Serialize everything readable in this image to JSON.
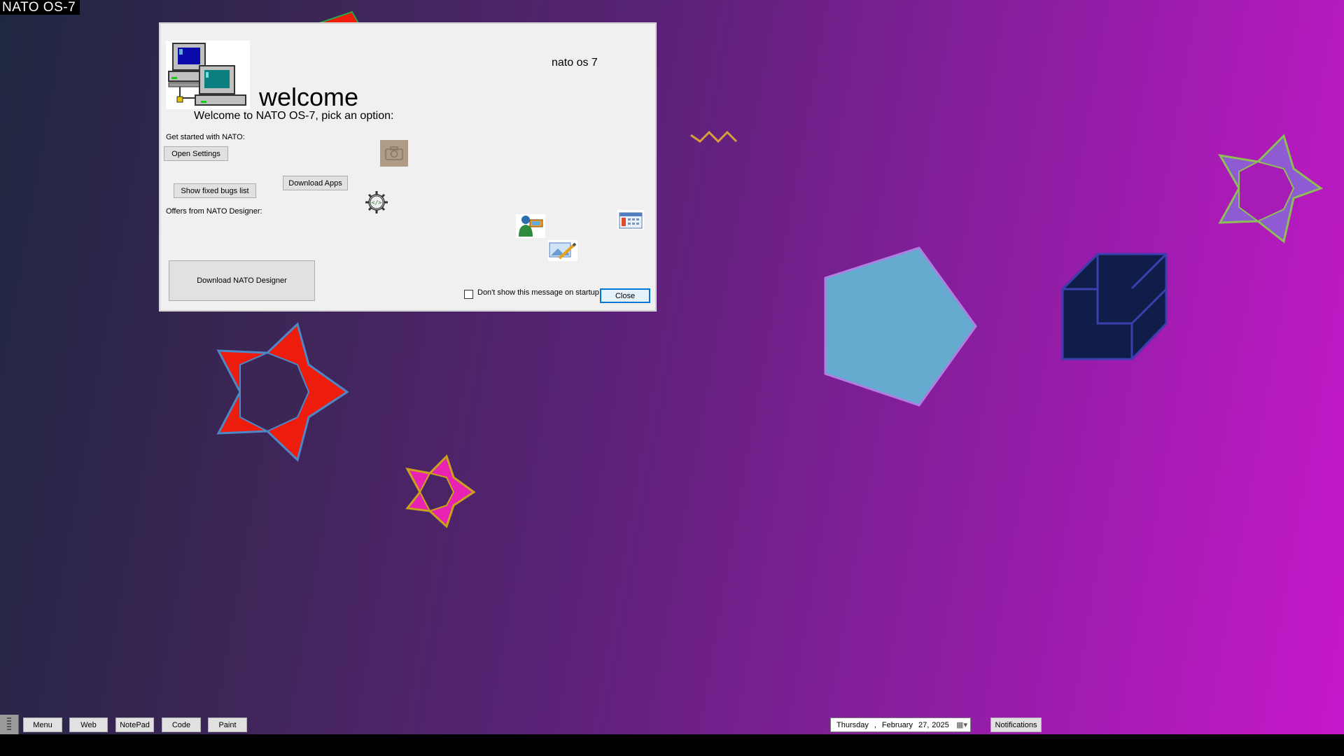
{
  "os_title": "NATO OS-7",
  "welcome_window": {
    "brand": "nato os 7",
    "title": "welcome",
    "subtitle": "Welcome to NATO OS-7, pick an option:",
    "get_started_label": "Get started with NATO:",
    "open_settings_label": "Open Settings",
    "download_apps_label": "Download Apps",
    "show_bugs_label": "Show fixed bugs list",
    "offers_label": "Offers from NATO Designer:",
    "download_designer_label": "Download NATO Designer",
    "dont_show_label": "Don't show this message on startup",
    "dont_show_checked": false,
    "close_label": "Close",
    "icons": [
      "network-computers-icon",
      "camera-icon",
      "code-gear-icon",
      "user-with-device-icon",
      "calendar-icon",
      "image-edit-icon"
    ]
  },
  "taskbar": {
    "apps": [
      "Menu",
      "Web",
      "NotePad",
      "Code",
      "Paint"
    ],
    "date": {
      "day": "Thursday",
      "sep": ",",
      "month": "February",
      "daynum": "27,",
      "year": "2025"
    },
    "notifications_label": "Notifications"
  },
  "colors": {
    "gradient_left": "#1f2740",
    "gradient_right": "#c718cb",
    "red_star": "#ee1c0c",
    "pink_star": "#e823b4",
    "pentagon": "#64abcf",
    "cube": "#0f1d48",
    "violet_star": "#8e5bd2"
  }
}
